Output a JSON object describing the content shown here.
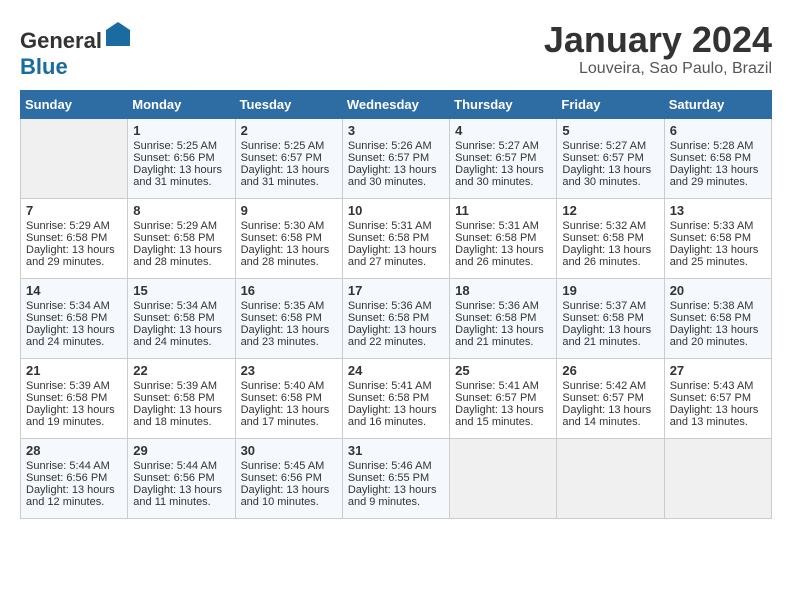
{
  "header": {
    "logo_general": "General",
    "logo_blue": "Blue",
    "month": "January 2024",
    "location": "Louveira, Sao Paulo, Brazil"
  },
  "days_of_week": [
    "Sunday",
    "Monday",
    "Tuesday",
    "Wednesday",
    "Thursday",
    "Friday",
    "Saturday"
  ],
  "weeks": [
    [
      {
        "day": "",
        "sunrise": "",
        "sunset": "",
        "daylight": "",
        "empty": true
      },
      {
        "day": "1",
        "sunrise": "Sunrise: 5:25 AM",
        "sunset": "Sunset: 6:56 PM",
        "daylight": "Daylight: 13 hours and 31 minutes."
      },
      {
        "day": "2",
        "sunrise": "Sunrise: 5:25 AM",
        "sunset": "Sunset: 6:57 PM",
        "daylight": "Daylight: 13 hours and 31 minutes."
      },
      {
        "day": "3",
        "sunrise": "Sunrise: 5:26 AM",
        "sunset": "Sunset: 6:57 PM",
        "daylight": "Daylight: 13 hours and 30 minutes."
      },
      {
        "day": "4",
        "sunrise": "Sunrise: 5:27 AM",
        "sunset": "Sunset: 6:57 PM",
        "daylight": "Daylight: 13 hours and 30 minutes."
      },
      {
        "day": "5",
        "sunrise": "Sunrise: 5:27 AM",
        "sunset": "Sunset: 6:57 PM",
        "daylight": "Daylight: 13 hours and 30 minutes."
      },
      {
        "day": "6",
        "sunrise": "Sunrise: 5:28 AM",
        "sunset": "Sunset: 6:58 PM",
        "daylight": "Daylight: 13 hours and 29 minutes."
      }
    ],
    [
      {
        "day": "7",
        "sunrise": "Sunrise: 5:29 AM",
        "sunset": "Sunset: 6:58 PM",
        "daylight": "Daylight: 13 hours and 29 minutes."
      },
      {
        "day": "8",
        "sunrise": "Sunrise: 5:29 AM",
        "sunset": "Sunset: 6:58 PM",
        "daylight": "Daylight: 13 hours and 28 minutes."
      },
      {
        "day": "9",
        "sunrise": "Sunrise: 5:30 AM",
        "sunset": "Sunset: 6:58 PM",
        "daylight": "Daylight: 13 hours and 28 minutes."
      },
      {
        "day": "10",
        "sunrise": "Sunrise: 5:31 AM",
        "sunset": "Sunset: 6:58 PM",
        "daylight": "Daylight: 13 hours and 27 minutes."
      },
      {
        "day": "11",
        "sunrise": "Sunrise: 5:31 AM",
        "sunset": "Sunset: 6:58 PM",
        "daylight": "Daylight: 13 hours and 26 minutes."
      },
      {
        "day": "12",
        "sunrise": "Sunrise: 5:32 AM",
        "sunset": "Sunset: 6:58 PM",
        "daylight": "Daylight: 13 hours and 26 minutes."
      },
      {
        "day": "13",
        "sunrise": "Sunrise: 5:33 AM",
        "sunset": "Sunset: 6:58 PM",
        "daylight": "Daylight: 13 hours and 25 minutes."
      }
    ],
    [
      {
        "day": "14",
        "sunrise": "Sunrise: 5:34 AM",
        "sunset": "Sunset: 6:58 PM",
        "daylight": "Daylight: 13 hours and 24 minutes."
      },
      {
        "day": "15",
        "sunrise": "Sunrise: 5:34 AM",
        "sunset": "Sunset: 6:58 PM",
        "daylight": "Daylight: 13 hours and 24 minutes."
      },
      {
        "day": "16",
        "sunrise": "Sunrise: 5:35 AM",
        "sunset": "Sunset: 6:58 PM",
        "daylight": "Daylight: 13 hours and 23 minutes."
      },
      {
        "day": "17",
        "sunrise": "Sunrise: 5:36 AM",
        "sunset": "Sunset: 6:58 PM",
        "daylight": "Daylight: 13 hours and 22 minutes."
      },
      {
        "day": "18",
        "sunrise": "Sunrise: 5:36 AM",
        "sunset": "Sunset: 6:58 PM",
        "daylight": "Daylight: 13 hours and 21 minutes."
      },
      {
        "day": "19",
        "sunrise": "Sunrise: 5:37 AM",
        "sunset": "Sunset: 6:58 PM",
        "daylight": "Daylight: 13 hours and 21 minutes."
      },
      {
        "day": "20",
        "sunrise": "Sunrise: 5:38 AM",
        "sunset": "Sunset: 6:58 PM",
        "daylight": "Daylight: 13 hours and 20 minutes."
      }
    ],
    [
      {
        "day": "21",
        "sunrise": "Sunrise: 5:39 AM",
        "sunset": "Sunset: 6:58 PM",
        "daylight": "Daylight: 13 hours and 19 minutes."
      },
      {
        "day": "22",
        "sunrise": "Sunrise: 5:39 AM",
        "sunset": "Sunset: 6:58 PM",
        "daylight": "Daylight: 13 hours and 18 minutes."
      },
      {
        "day": "23",
        "sunrise": "Sunrise: 5:40 AM",
        "sunset": "Sunset: 6:58 PM",
        "daylight": "Daylight: 13 hours and 17 minutes."
      },
      {
        "day": "24",
        "sunrise": "Sunrise: 5:41 AM",
        "sunset": "Sunset: 6:58 PM",
        "daylight": "Daylight: 13 hours and 16 minutes."
      },
      {
        "day": "25",
        "sunrise": "Sunrise: 5:41 AM",
        "sunset": "Sunset: 6:57 PM",
        "daylight": "Daylight: 13 hours and 15 minutes."
      },
      {
        "day": "26",
        "sunrise": "Sunrise: 5:42 AM",
        "sunset": "Sunset: 6:57 PM",
        "daylight": "Daylight: 13 hours and 14 minutes."
      },
      {
        "day": "27",
        "sunrise": "Sunrise: 5:43 AM",
        "sunset": "Sunset: 6:57 PM",
        "daylight": "Daylight: 13 hours and 13 minutes."
      }
    ],
    [
      {
        "day": "28",
        "sunrise": "Sunrise: 5:44 AM",
        "sunset": "Sunset: 6:56 PM",
        "daylight": "Daylight: 13 hours and 12 minutes."
      },
      {
        "day": "29",
        "sunrise": "Sunrise: 5:44 AM",
        "sunset": "Sunset: 6:56 PM",
        "daylight": "Daylight: 13 hours and 11 minutes."
      },
      {
        "day": "30",
        "sunrise": "Sunrise: 5:45 AM",
        "sunset": "Sunset: 6:56 PM",
        "daylight": "Daylight: 13 hours and 10 minutes."
      },
      {
        "day": "31",
        "sunrise": "Sunrise: 5:46 AM",
        "sunset": "Sunset: 6:55 PM",
        "daylight": "Daylight: 13 hours and 9 minutes."
      },
      {
        "day": "",
        "sunrise": "",
        "sunset": "",
        "daylight": "",
        "empty": true
      },
      {
        "day": "",
        "sunrise": "",
        "sunset": "",
        "daylight": "",
        "empty": true
      },
      {
        "day": "",
        "sunrise": "",
        "sunset": "",
        "daylight": "",
        "empty": true
      }
    ]
  ]
}
